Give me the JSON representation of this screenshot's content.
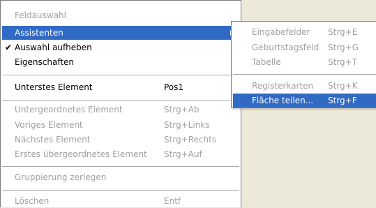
{
  "main_menu": {
    "feldauswahl": "Feldauswahl",
    "assistenten": "Assistenten",
    "auswahl_aufheben": "Auswahl aufheben",
    "eigenschaften": "Eigenschaften",
    "unterstes_element": "Unterstes Element",
    "unterstes_element_shortcut": "Pos1",
    "untergeordnetes_element": "Untergeordnetes Element",
    "untergeordnetes_element_shortcut": "Strg+Ab",
    "voriges_element": "Voriges Element",
    "voriges_element_shortcut": "Strg+Links",
    "naechstes_element": "Nächstes Element",
    "naechstes_element_shortcut": "Strg+Rechts",
    "erstes_uebergeordnetes_element": "Erstes übergeordnetes Element",
    "erstes_uebergeordnetes_element_shortcut": "Strg+Auf",
    "gruppierung_zerlegen": "Gruppierung zerlegen",
    "loeschen": "Löschen",
    "loeschen_shortcut": "Entf"
  },
  "sub_menu": {
    "eingabefelder": "Eingabefelder",
    "eingabefelder_shortcut": "Strg+E",
    "geburtstagsfeld": "Geburtstagsfeld",
    "geburtstagsfeld_shortcut": "Strg+G",
    "tabelle": "Tabelle",
    "tabelle_shortcut": "Strg+T",
    "registerkarten": "Registerkarten",
    "registerkarten_shortcut": "Strg+K",
    "flaeche_teilen": "Fläche teilen...",
    "flaeche_teilen_shortcut": "Strg+F"
  },
  "colors": {
    "highlight": "#316ac5",
    "disabled": "#a0a0a0",
    "background": "#ece9d8"
  },
  "icons": {
    "check": "checkmark-icon",
    "submenu_arrow": "submenu-arrow-icon"
  }
}
